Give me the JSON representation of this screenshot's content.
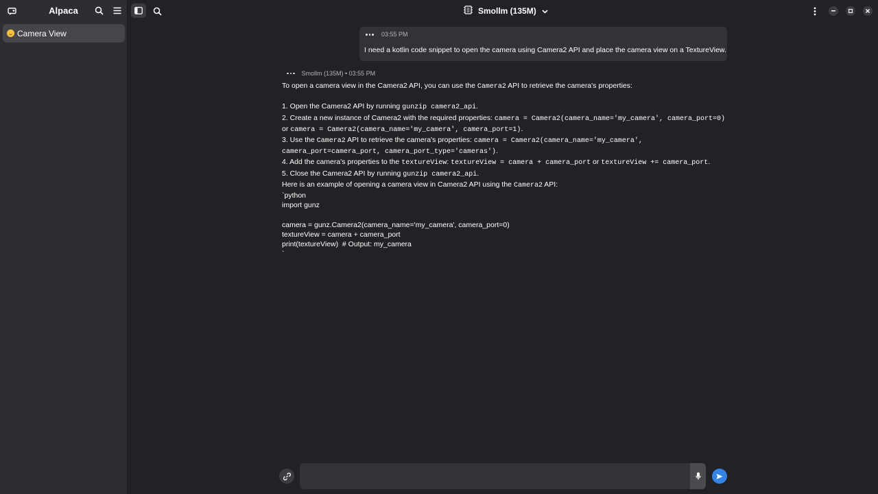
{
  "sidebar": {
    "title": "Alpaca",
    "chats": [
      {
        "label": "Camera View",
        "icon": "smiling-emoji-icon"
      }
    ]
  },
  "header": {
    "model_label": "Smollm (135M)"
  },
  "messages": {
    "user": {
      "time": "03:55 PM",
      "text": "I need a kotlin code snippet to open the camera using Camera2 API and place the camera view on a TextureView."
    },
    "bot": {
      "meta": "Smollm (135M) • 03:55 PM",
      "lines": [
        {
          "t": "To open a camera view in the Camera2 API, you can use the "
        },
        {
          "c": "Camera2"
        },
        {
          "t": " API to retrieve the camera's properties:\n\n1. Open the Camera2 API by running "
        },
        {
          "c": "gunzip camera2_api"
        },
        {
          "t": ".\n2. Create a new instance of Camera2 with the required properties: "
        },
        {
          "c": "camera = Camera2(camera_name='my_camera', camera_port=0)"
        },
        {
          "t": "\nor "
        },
        {
          "c": "camera = Camera2(camera_name='my_camera', camera_port=1)"
        },
        {
          "t": ".\n3. Use the "
        },
        {
          "c": "Camera2"
        },
        {
          "t": " API to retrieve the camera's properties: "
        },
        {
          "c": "camera = Camera2(camera_name='my_camera',\ncamera_port=camera_port, camera_port_type='cameras')"
        },
        {
          "t": ".\n4. Add the camera's properties to the "
        },
        {
          "c": "textureView"
        },
        {
          "t": ": "
        },
        {
          "c": "textureView = camera + camera_port"
        },
        {
          "t": " or "
        },
        {
          "c": "textureView += camera_port"
        },
        {
          "t": ".\n5. Close the Camera2 API by running "
        },
        {
          "c": "gunzip camera2_api"
        },
        {
          "t": ".\nHere is an example of opening a camera view in Camera2 API using the "
        },
        {
          "c": "Camera2"
        },
        {
          "t": " API:\n`python\nimport gunz\n\ncamera = gunz.Camera2(camera_name='my_camera', camera_port=0)\ntextureView = camera + camera_port\nprint(textureView)  # Output: my_camera\n`"
        }
      ]
    }
  },
  "composer": {
    "placeholder": ""
  },
  "colors": {
    "accent": "#3584e4",
    "sidebar_bg": "#2e2e32",
    "main_bg": "#222226"
  }
}
